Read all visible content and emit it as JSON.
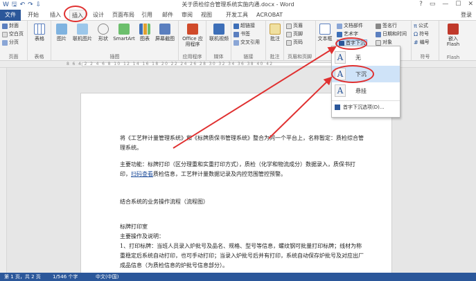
{
  "titlebar": {
    "title": "关于质检综合管理系统实施内通.docx - Word",
    "qat": [
      "W",
      "🖫",
      "↶",
      "↷",
      "⇩"
    ],
    "win_controls": [
      "?",
      "▭",
      "—",
      "☐",
      "✕"
    ]
  },
  "tabs": {
    "file": "文件",
    "items": [
      "开始",
      "插入",
      "设计",
      "页面布局",
      "引用",
      "邮件",
      "审阅",
      "视图",
      "开发工具",
      "ACROBAT"
    ],
    "login": "登录"
  },
  "ribbon": {
    "pages_group": {
      "items": [
        "封面",
        "空白页",
        "分页"
      ],
      "label": "页面"
    },
    "table_group": {
      "button": "表格",
      "label": "表格"
    },
    "illustrations_group": {
      "buttons": [
        "图片",
        "联机图片",
        "形状",
        "SmartArt",
        "图表",
        "屏幕截图"
      ],
      "label": "插图"
    },
    "apps_group": {
      "button": "Office 应用程序",
      "label": "应用程序"
    },
    "media_group": {
      "button": "联机视频",
      "label": "媒体"
    },
    "links_group": {
      "items": [
        "超链接",
        "书签",
        "交叉引用"
      ],
      "label": "链接"
    },
    "comments_group": {
      "button": "批注",
      "label": "批注"
    },
    "header_group": {
      "items": [
        "页眉",
        "页脚",
        "页码"
      ],
      "label": "页眉和页脚"
    },
    "text_group": {
      "button": "文本框",
      "items": [
        "文档部件",
        "艺术字",
        "首字下沉"
      ],
      "items2": [
        "签名行",
        "日期和时间",
        "对象"
      ],
      "label": "文本"
    },
    "symbols_group": {
      "items": [
        "公式",
        "符号",
        "编号"
      ],
      "label": "符号"
    },
    "flash_group": {
      "button": "嵌入 Flash",
      "label": "Flash"
    }
  },
  "ruler": {
    "numbers": "8 6 4 2 2 4 6 8 10 12 14 16 18 20 22 24 26 28 30 32 34 36 38 40 42"
  },
  "document": {
    "paragraphs": [
      "将《工艺秤计量管理系统》和《标牌质保书管理系统》整合为同一个平台上，名称暂定：质检综合管理系统。",
      "主要功能：标牌打印（区分理重和实重打印方式），质检（化学和物流成分）数据录入，质保书打印，",
      "扫码查看",
      "质检信息，工艺秤计量数据记录及内控范围管控预警。",
      "结合系统的业务操作流程（流程图）",
      "标牌打印室",
      "主要操作及说明：",
      "1、打印标牌：当班人员录入炉批号及品名、规格、型号等信息，螺纹钢可批量打印标牌；线材为称重稳定后系统自动打印，也可手动打印；当录入炉批号后并有打印，系统自动保存炉批号及对应出厂成品信息（为质检信息的炉批号信息部分）。"
    ]
  },
  "dropdown": {
    "items": [
      "无",
      "下沉",
      "悬挂"
    ],
    "options_label": "首字下沉选项(D)..."
  },
  "statusbar": {
    "page": "第 1 页，共 2 页",
    "words": "1/546 个字",
    "lang": "中文(中国)"
  }
}
